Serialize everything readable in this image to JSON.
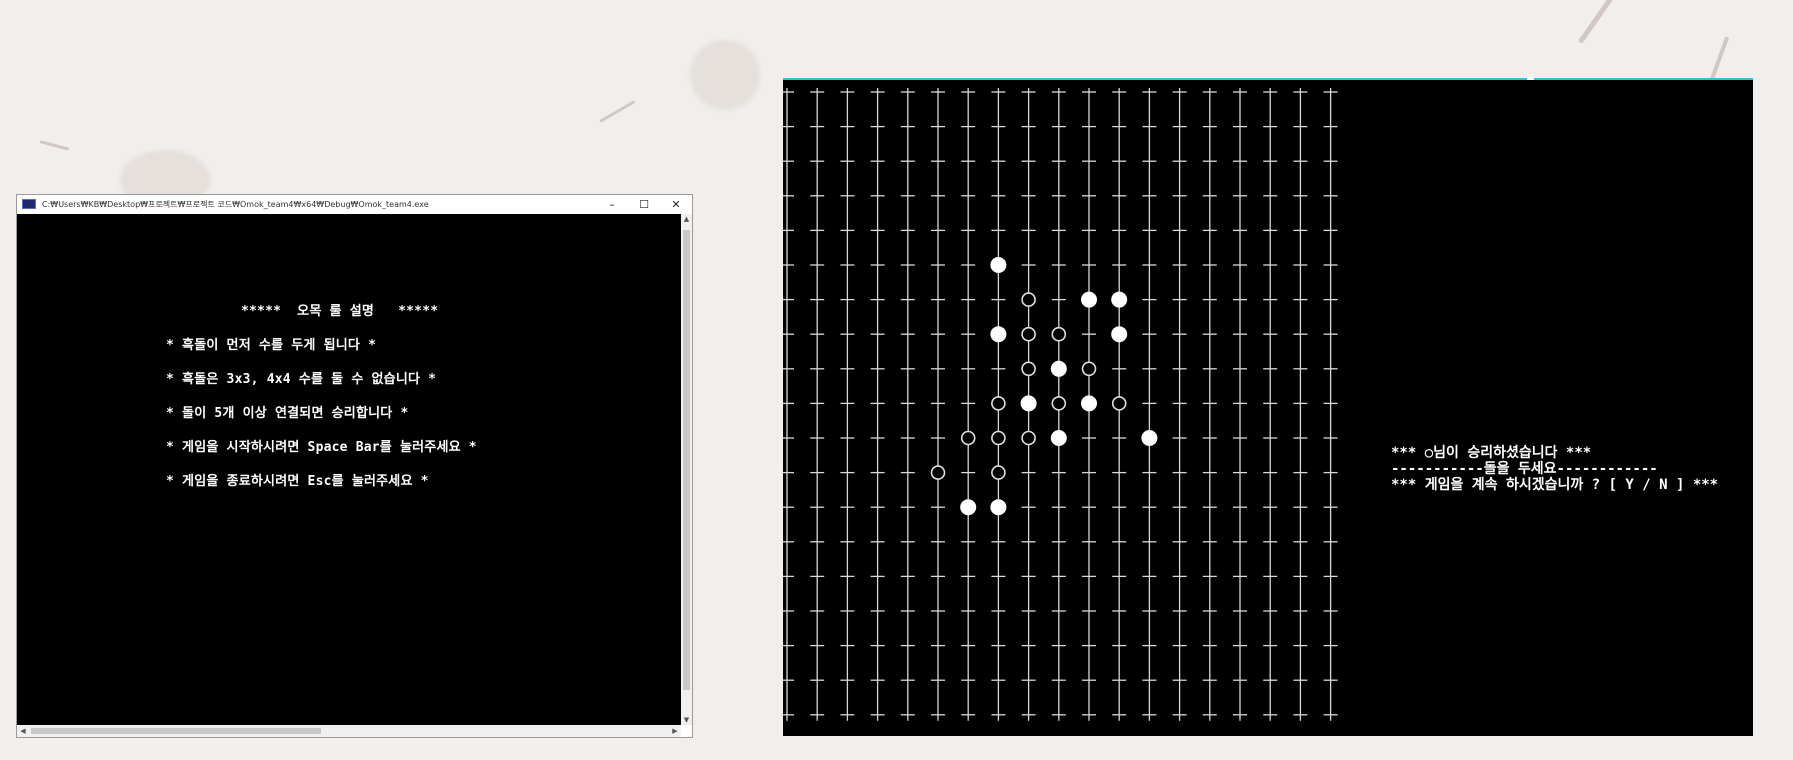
{
  "console_window": {
    "title": "C:₩Users₩KB₩Desktop₩프로젝트₩프로젝트 코드₩Omok_team4₩x64₩Debug₩Omok_team4.exe",
    "controls": {
      "minimize": "–",
      "maximize": "☐",
      "close": "✕"
    },
    "heading": "*****  오목 룰 설명   *****",
    "rules": [
      "* 흑돌이 먼저 수를 두게 됩니다 *",
      "* 흑돌은 3x3, 4x4 수를 둘 수 없습니다 *",
      "* 돌이 5개 이상 연결되면 승리합니다 *",
      "* 게임을 시작하시려면 Space Bar를 눌러주세요 *",
      "* 게임을 종료하시려면 Esc를 눌러주세요 *"
    ]
  },
  "game_screen": {
    "board": {
      "columns": 19,
      "rows": 19,
      "stones": [
        {
          "col": 7,
          "row": 5,
          "color": "white"
        },
        {
          "col": 8,
          "row": 6,
          "color": "black"
        },
        {
          "col": 10,
          "row": 6,
          "color": "white"
        },
        {
          "col": 11,
          "row": 6,
          "color": "white"
        },
        {
          "col": 7,
          "row": 7,
          "color": "white"
        },
        {
          "col": 8,
          "row": 7,
          "color": "black"
        },
        {
          "col": 9,
          "row": 7,
          "color": "black"
        },
        {
          "col": 11,
          "row": 7,
          "color": "white"
        },
        {
          "col": 8,
          "row": 8,
          "color": "black"
        },
        {
          "col": 9,
          "row": 8,
          "color": "white"
        },
        {
          "col": 10,
          "row": 8,
          "color": "black"
        },
        {
          "col": 7,
          "row": 9,
          "color": "black"
        },
        {
          "col": 8,
          "row": 9,
          "color": "white"
        },
        {
          "col": 9,
          "row": 9,
          "color": "black"
        },
        {
          "col": 10,
          "row": 9,
          "color": "white"
        },
        {
          "col": 11,
          "row": 9,
          "color": "black"
        },
        {
          "col": 6,
          "row": 10,
          "color": "black"
        },
        {
          "col": 7,
          "row": 10,
          "color": "black"
        },
        {
          "col": 8,
          "row": 10,
          "color": "black"
        },
        {
          "col": 9,
          "row": 10,
          "color": "white"
        },
        {
          "col": 12,
          "row": 10,
          "color": "white"
        },
        {
          "col": 5,
          "row": 11,
          "color": "black"
        },
        {
          "col": 7,
          "row": 11,
          "color": "black"
        },
        {
          "col": 6,
          "row": 12,
          "color": "white"
        },
        {
          "col": 7,
          "row": 12,
          "color": "white"
        }
      ]
    },
    "messages": {
      "win": "*** ○님이 승리하셨습니다 ***",
      "place": "-----------돌을 두세요------------",
      "continue": "*** 게임을 계속 하시겠습니까 ? [ Y / N ] ***"
    }
  },
  "colors": {
    "console_bg": "#000000",
    "text": "#ffffff",
    "accent": "#29c4d8"
  }
}
